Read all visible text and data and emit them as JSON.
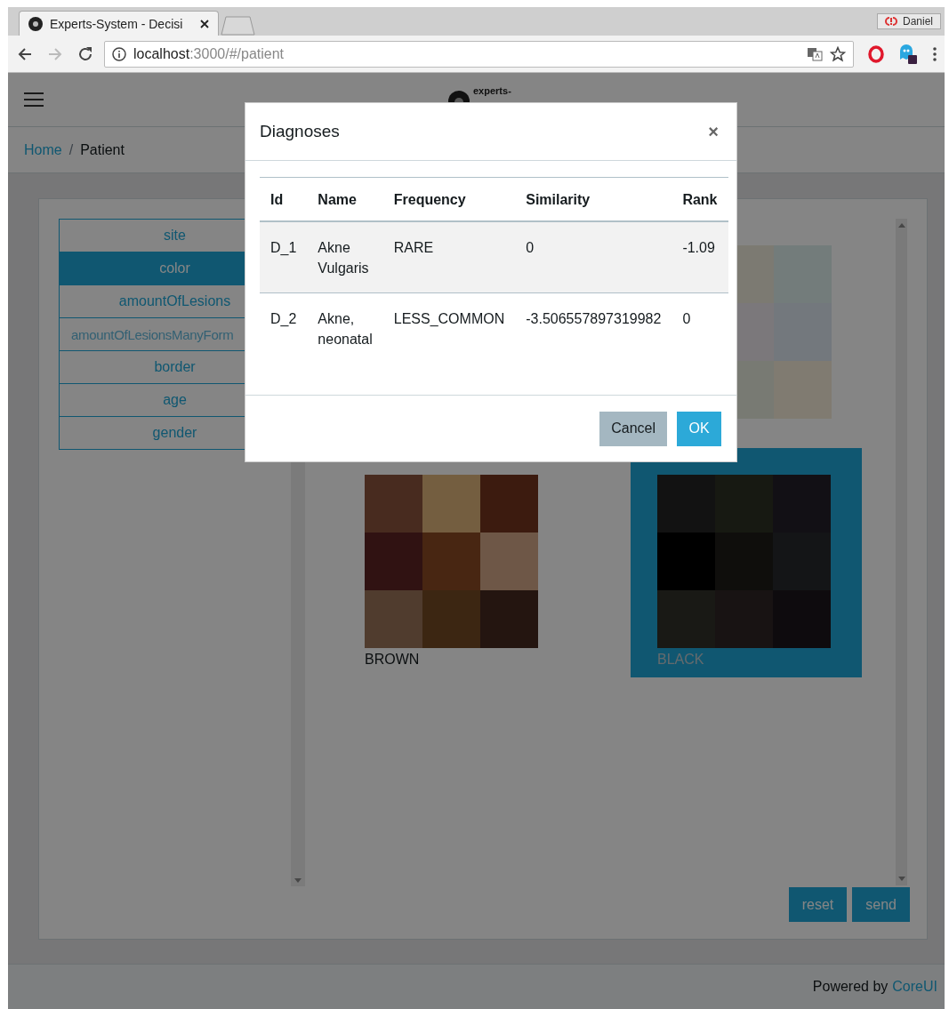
{
  "browser": {
    "tabs": [
      {
        "title": "Experts-System - Decisi",
        "selected": true
      }
    ],
    "profile": "Daniel",
    "url": {
      "host": "localhost",
      "rest": ":3000/#/patient"
    }
  },
  "header": {
    "brand": "experts-"
  },
  "breadcrumb": {
    "separator": "/",
    "items": [
      {
        "label": "Home",
        "kind": "link"
      },
      {
        "label": "Patient",
        "kind": "current"
      }
    ]
  },
  "sidebar": {
    "items": [
      {
        "label": "site",
        "selected": false,
        "disabled": false
      },
      {
        "label": "color",
        "selected": true,
        "disabled": false
      },
      {
        "label": "amountOfLesions",
        "selected": false,
        "disabled": false
      },
      {
        "label": "amountOfLesionsManyForm",
        "selected": false,
        "disabled": true
      },
      {
        "label": "border",
        "selected": false,
        "disabled": false
      },
      {
        "label": "age",
        "selected": false,
        "disabled": false
      },
      {
        "label": "gender",
        "selected": false,
        "disabled": false
      }
    ]
  },
  "options": [
    {
      "label": "BROWN",
      "selected": false
    },
    {
      "label": "BLACK",
      "selected": true
    }
  ],
  "actions": [
    "reset",
    "send"
  ],
  "footer": {
    "text": "Powered by",
    "link": "CoreUI"
  },
  "modal": {
    "title": "Diagnoses",
    "close": "×",
    "table": {
      "columns": [
        "Id",
        "Name",
        "Frequency",
        "Similarity",
        "Rank"
      ],
      "rows": [
        {
          "highlighted": true,
          "cells": [
            "D_1",
            "Akne Vulgaris",
            "RARE",
            "0",
            "-1.09"
          ]
        },
        {
          "highlighted": false,
          "cells": [
            "D_2",
            "Akne, neonatal",
            "LESS_COMMON",
            "-3.506557897319982",
            "0"
          ]
        }
      ]
    },
    "buttons": [
      {
        "label": "Cancel",
        "kind": "secondary"
      },
      {
        "label": "OK",
        "kind": "primary"
      }
    ]
  }
}
